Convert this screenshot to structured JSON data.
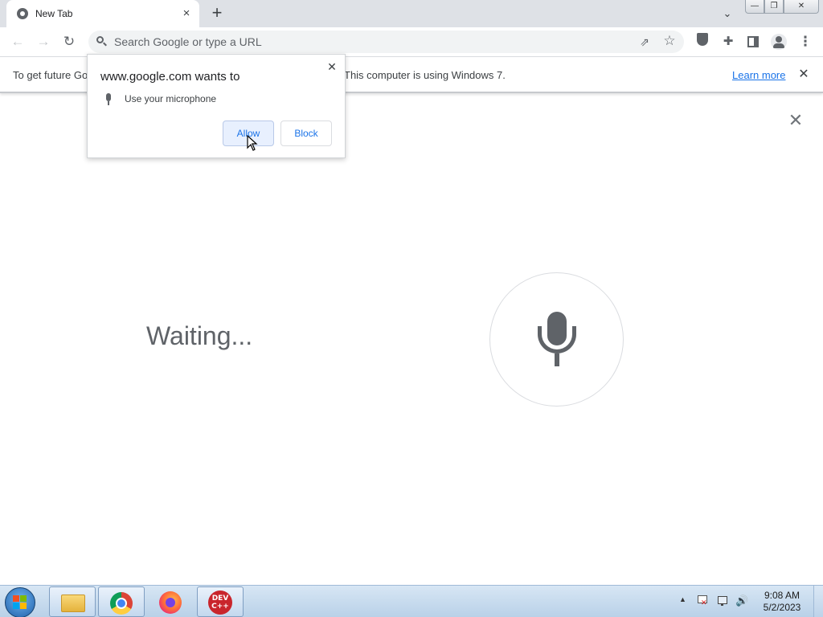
{
  "tabstrip": {
    "tab_title": "New Tab",
    "tab_close_icon": "×",
    "new_tab_icon": "+",
    "tab_search_icon": "⌄",
    "window_buttons": {
      "minimize": "—",
      "restore": "❐",
      "close": "✕"
    }
  },
  "toolbar": {
    "back_icon": "←",
    "forward_icon": "→",
    "reload_icon": "↻",
    "omnibox_placeholder": "Search Google or type a URL",
    "share_icon": "⇗",
    "bookmark_icon": "☆",
    "extensions_icon": "✚",
    "menu_icon": "⋮"
  },
  "infobar": {
    "text_left": "To get future Go",
    "text_right": "This computer is using Windows 7.",
    "learn_more": "Learn more",
    "close_icon": "✕"
  },
  "permission_popup": {
    "title": "www.google.com wants to",
    "permission": "Use your microphone",
    "allow_label": "Allow",
    "block_label": "Block",
    "close_icon": "✕"
  },
  "voice_search": {
    "status": "Waiting...",
    "close_icon": "✕"
  },
  "taskbar": {
    "apps": [
      "Windows Explorer",
      "Google Chrome",
      "Firefox",
      "Dev-C++"
    ],
    "devcpp_label": "DEV\nC++",
    "tray_expand": "▲",
    "volume_icon": "🔊",
    "time": "9:08 AM",
    "date": "5/2/2023"
  }
}
